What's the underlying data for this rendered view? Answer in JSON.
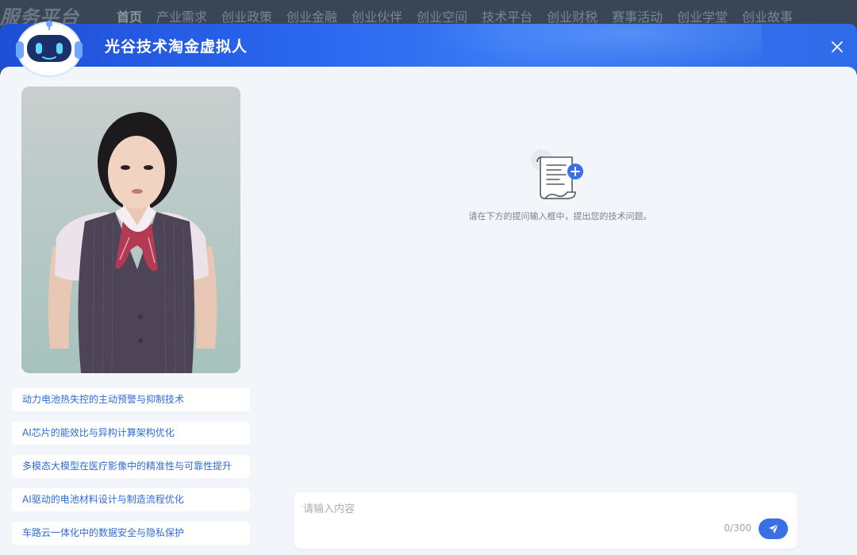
{
  "site": {
    "logo_text": "服务平台",
    "nav": [
      "首页",
      "产业需求",
      "创业政策",
      "创业金融",
      "创业伙伴",
      "创业空间",
      "技术平台",
      "创业财税",
      "赛事活动",
      "创业学堂",
      "创业故事"
    ]
  },
  "modal": {
    "title": "光谷技术淘金虚拟人",
    "close_icon": "close-icon"
  },
  "suggestions": [
    "动力电池热失控的主动预警与抑制技术",
    "AI芯片的能效比与异构计算架构优化",
    "多模态大模型在医疗影像中的精准性与可靠性提升",
    "AI驱动的电池材料设计与制造流程优化",
    "车路云一体化中的数据安全与隐私保护"
  ],
  "empty_state": {
    "icon": "document-add-icon",
    "text": "请在下方的提问输入框中，提出您的技术问题。"
  },
  "input": {
    "placeholder": "请输入内容",
    "value": "",
    "char_count": "0/300",
    "send_icon": "send-icon"
  },
  "colors": {
    "accent": "#3b6fe4",
    "header_blue": "#2a66ee",
    "suggestion_text": "#2f6bd8"
  }
}
